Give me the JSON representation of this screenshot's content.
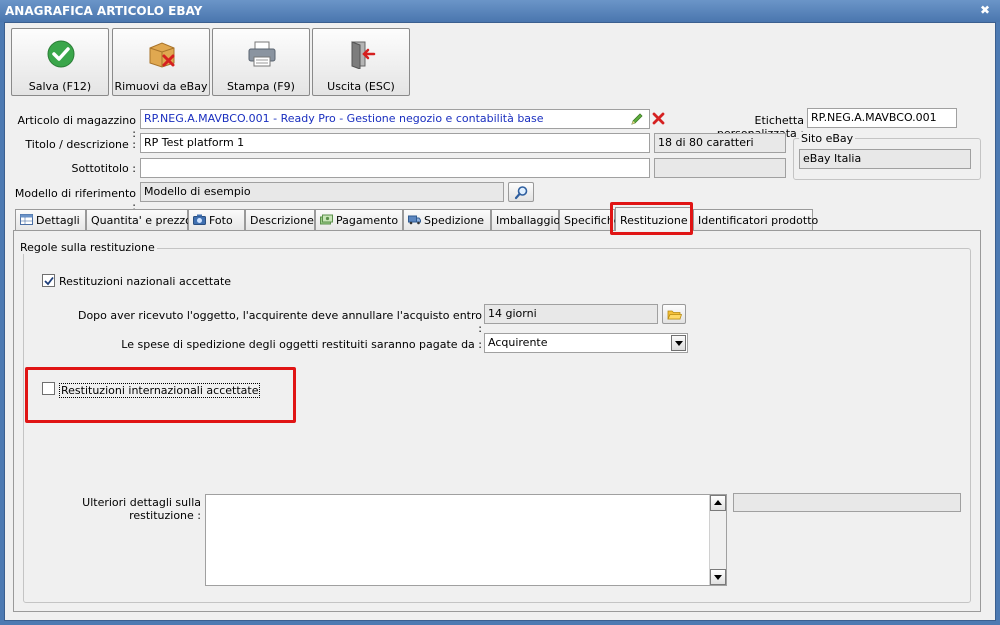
{
  "window": {
    "title": "ANAGRAFICA ARTICOLO EBAY"
  },
  "toolbar": {
    "save_label": "Salva (F12)",
    "remove_label": "Rimuovi da eBay",
    "print_label": "Stampa (F9)",
    "exit_label": "Uscita (ESC)"
  },
  "form": {
    "articolo_label": "Articolo di magazzino :",
    "articolo_value": "RP.NEG.A.MAVBCO.001 - Ready Pro - Gestione negozio e contabilità base",
    "etichetta_label": "Etichetta personalizzata :",
    "etichetta_value": "RP.NEG.A.MAVBCO.001",
    "titolo_label": "Titolo / descrizione :",
    "titolo_value": "RP Test platform 1",
    "titolo_counter": "18 di 80 caratteri",
    "sottotitolo_label": "Sottotitolo :",
    "sottotitolo_value": "",
    "modello_label": "Modello di riferimento :",
    "modello_value": "Modello di esempio",
    "sito_label": "Sito eBay",
    "sito_value": "eBay Italia"
  },
  "tabs": [
    {
      "label": "Dettagli"
    },
    {
      "label": "Quantita' e prezzo"
    },
    {
      "label": "Foto"
    },
    {
      "label": "Descrizione"
    },
    {
      "label": "Pagamento"
    },
    {
      "label": "Spedizione"
    },
    {
      "label": "Imballaggio"
    },
    {
      "label": "Specifiche"
    },
    {
      "label": "Restituzione"
    },
    {
      "label": "Identificatori prodotto"
    }
  ],
  "restituzione": {
    "group_label": "Regole sulla restituzione",
    "nazionali_label": "Restituzioni nazionali accettate",
    "nazionali_checked": true,
    "entro_label": "Dopo aver ricevuto l'oggetto, l'acquirente deve annullare l'acquisto entro :",
    "entro_value": "14 giorni",
    "spese_label": "Le spese di spedizione degli oggetti restituiti saranno pagate da :",
    "spese_value": "Acquirente",
    "internazionali_label": "Restituzioni internazionali accettate",
    "internazionali_checked": false,
    "ulteriori_label": "Ulteriori dettagli sulla restituzione :"
  },
  "colors": {
    "highlight": "#e01414",
    "title_bar": "#4a76ae",
    "link_text": "#1a2fbf"
  }
}
